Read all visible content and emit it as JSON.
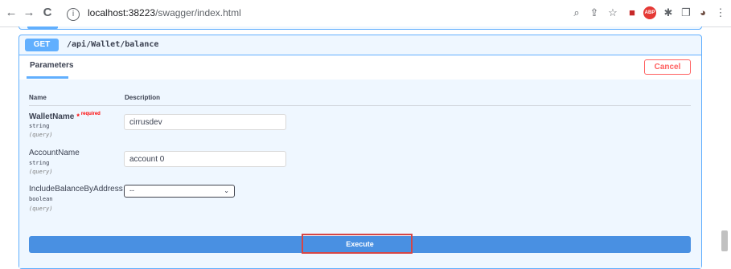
{
  "browser": {
    "back": "←",
    "forward": "→",
    "reload": "C",
    "info": "i",
    "url_host": "localhost:38223",
    "url_path": "/swagger/index.html",
    "ext_icons": [
      "⌕",
      "⇪",
      "☆",
      "■",
      "ABP",
      "✱",
      "❐",
      "◕",
      "⋮"
    ]
  },
  "operation": {
    "method": "GET",
    "path": "/api/Wallet/balance"
  },
  "parameters": {
    "tab_label": "Parameters",
    "cancel_label": "Cancel",
    "col_name": "Name",
    "col_description": "Description",
    "items": [
      {
        "name": "WalletName",
        "required_star": "*",
        "required_text": "required",
        "type": "string",
        "in": "(query)",
        "value": "cirrusdev"
      },
      {
        "name": "AccountName",
        "type": "string",
        "in": "(query)",
        "value": "account 0"
      },
      {
        "name": "IncludeBalanceByAddress",
        "type": "boolean",
        "in": "(query)",
        "value": "--",
        "chevron": "⌄"
      }
    ]
  },
  "execute_label": "Execute",
  "colors": {
    "get_blue": "#61affe",
    "execute_blue": "#4990e2",
    "cancel_red": "#ff6060",
    "highlight_red": "#d64545"
  }
}
